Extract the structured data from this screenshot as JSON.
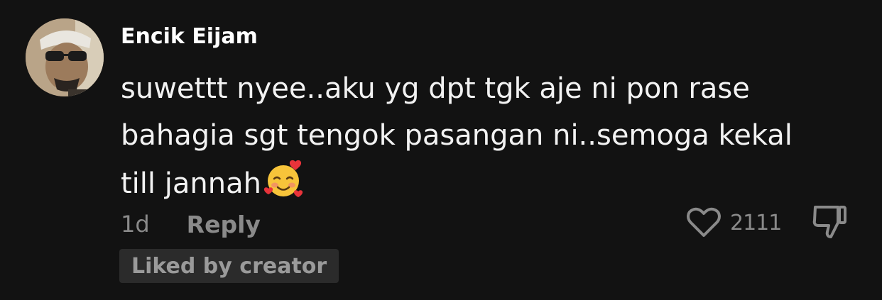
{
  "comment": {
    "username": "Encik Eijam",
    "text_lines": [
      "suwettt nyee..aku yg dpt tgk aje ni pon rase",
      "bahagia sgt tengok pasangan ni..semoga kekal",
      "till jannah"
    ],
    "emoji": "smiling-face-with-hearts",
    "time": "1d",
    "reply_label": "Reply",
    "like_count": "2111",
    "badge": "Liked by creator"
  },
  "icons": {
    "like": "heart-outline-icon",
    "dislike": "thumbs-down-outline-icon"
  },
  "colors": {
    "background": "#121212",
    "primary_text": "#ffffff",
    "secondary_text": "#8a8a8a",
    "badge_bg": "#2b2b2b"
  }
}
